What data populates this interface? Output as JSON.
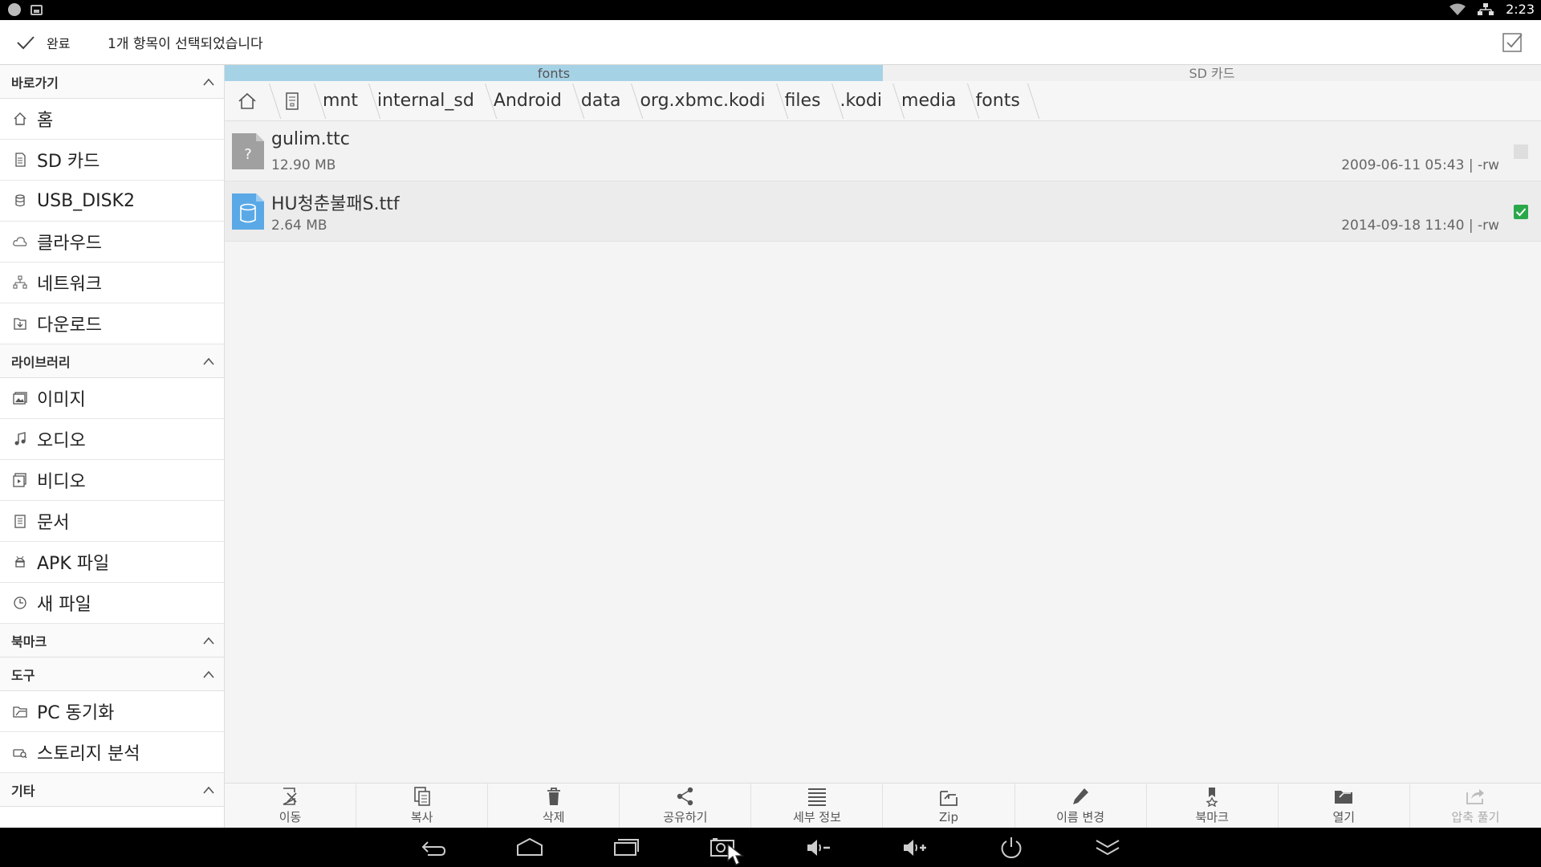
{
  "status_bar": {
    "time": "2:23"
  },
  "action_bar": {
    "done_label": "완료",
    "selection_text": "1개 항목이 선택되었습니다"
  },
  "sidebar": {
    "sections": [
      {
        "title": "바로가기",
        "items": [
          {
            "label": "홈",
            "icon": "home-icon"
          },
          {
            "label": "SD 카드",
            "icon": "sd-card-icon"
          },
          {
            "label": "USB_DISK2",
            "icon": "usb-drive-icon"
          },
          {
            "label": "클라우드",
            "icon": "cloud-icon"
          },
          {
            "label": "네트워크",
            "icon": "network-icon"
          },
          {
            "label": "다운로드",
            "icon": "download-icon"
          }
        ]
      },
      {
        "title": "라이브러리",
        "items": [
          {
            "label": "이미지",
            "icon": "image-icon"
          },
          {
            "label": "오디오",
            "icon": "music-icon"
          },
          {
            "label": "비디오",
            "icon": "video-icon"
          },
          {
            "label": "문서",
            "icon": "document-icon"
          },
          {
            "label": "APK 파일",
            "icon": "android-icon"
          },
          {
            "label": "새 파일",
            "icon": "clock-icon"
          }
        ]
      },
      {
        "title": "북마크",
        "items": []
      },
      {
        "title": "도구",
        "items": [
          {
            "label": "PC 동기화",
            "icon": "pc-sync-icon"
          },
          {
            "label": "스토리지 분석",
            "icon": "storage-analysis-icon"
          }
        ]
      },
      {
        "title": "기타",
        "items": []
      }
    ]
  },
  "tabs": [
    {
      "label": "fonts",
      "active": true
    },
    {
      "label": "SD 카드",
      "active": false
    }
  ],
  "breadcrumb": [
    "mnt",
    "internal_sd",
    "Android",
    "data",
    "org.xbmc.kodi",
    "files",
    ".kodi",
    "media",
    "fonts"
  ],
  "files": [
    {
      "name": "gulim.ttc",
      "size": "12.90 MB",
      "meta": "2009-06-11 05:43 | -rw",
      "selected": false,
      "icon": "unknown-file-icon"
    },
    {
      "name": "HU청춘불패S.ttf",
      "size": "2.64 MB",
      "meta": "2014-09-18 11:40 | -rw",
      "selected": true,
      "icon": "database-file-icon"
    }
  ],
  "toolbar": [
    {
      "label": "이동",
      "icon": "move-icon",
      "enabled": true
    },
    {
      "label": "복사",
      "icon": "copy-icon",
      "enabled": true
    },
    {
      "label": "삭제",
      "icon": "trash-icon",
      "enabled": true
    },
    {
      "label": "공유하기",
      "icon": "share-icon",
      "enabled": true
    },
    {
      "label": "세부 정보",
      "icon": "details-icon",
      "enabled": true
    },
    {
      "label": "Zip",
      "icon": "zip-icon",
      "enabled": true
    },
    {
      "label": "이름 변경",
      "icon": "rename-icon",
      "enabled": true
    },
    {
      "label": "북마크",
      "icon": "bookmark-icon",
      "enabled": true
    },
    {
      "label": "열기",
      "icon": "open-icon",
      "enabled": true
    },
    {
      "label": "압축 풀기",
      "icon": "extract-icon",
      "enabled": false
    }
  ],
  "colors": {
    "tab_active": "#a6d2e6",
    "check_selected": "#2aa84a",
    "file_icon_blue": "#5aa9e6",
    "file_icon_gray": "#a0a0a0"
  }
}
